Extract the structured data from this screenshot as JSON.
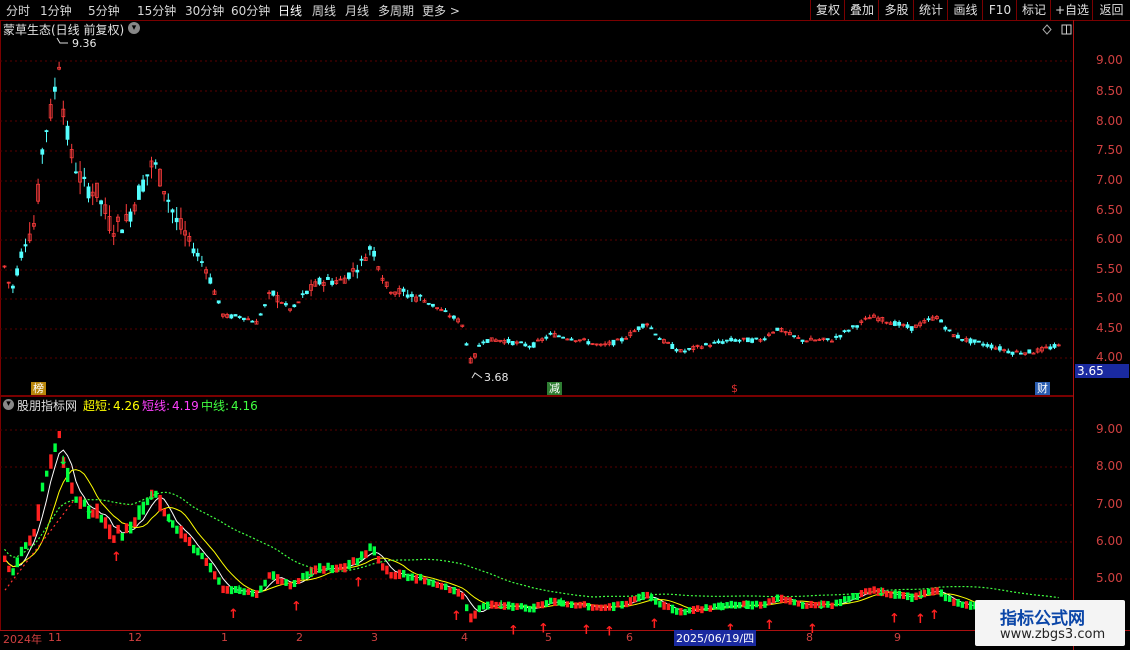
{
  "toolbar": {
    "periods": [
      "分时",
      "1分钟",
      "5分钟",
      "15分钟",
      "30分钟",
      "60分钟",
      "日线",
      "周线",
      "月线",
      "多周期",
      "更多 >"
    ],
    "active_period": "日线",
    "right_buttons": [
      "复权",
      "叠加",
      "多股",
      "统计",
      "画线",
      "F10",
      "标记",
      "+自选",
      "返回"
    ]
  },
  "main_pane": {
    "title": "蒙草生态(日线 前复权)",
    "high_label": "9.36",
    "low_label": "3.68",
    "current_price_box": "3.65",
    "y_ticks": [
      "9.00",
      "8.50",
      "8.00",
      "7.50",
      "7.00",
      "6.50",
      "6.00",
      "5.50",
      "5.00",
      "4.50",
      "4.00"
    ],
    "markers": [
      {
        "text": "榜",
        "color": "#b8860b"
      },
      {
        "text": "减",
        "color": "#2e7d32"
      },
      {
        "text": "$",
        "color": "#e03030"
      },
      {
        "text": "财",
        "color": "#2a5db0"
      }
    ]
  },
  "indicator_pane": {
    "title": "股朋指标网",
    "items": [
      {
        "label": "超短:",
        "value": "4.26",
        "color": "#ffff00"
      },
      {
        "label": "短线:",
        "value": "4.19",
        "color": "#ff40ff"
      },
      {
        "label": "中线:",
        "value": "4.16",
        "color": "#40ff40"
      }
    ],
    "y_ticks": [
      "9.00",
      "8.00",
      "7.00",
      "6.00",
      "5.00"
    ]
  },
  "time_axis": {
    "labels": [
      "2024年",
      "11",
      "12",
      "1",
      "2",
      "3",
      "4",
      "5",
      "6",
      "2025/06/19/四",
      "8",
      "9"
    ]
  },
  "watermark": {
    "title": "指标公式网",
    "url": "www.zbgs3.com"
  },
  "colors": {
    "up": "#ff3c3c",
    "down": "#54ffff",
    "grid": "#7a0000",
    "axis_text": "#d04040"
  }
}
